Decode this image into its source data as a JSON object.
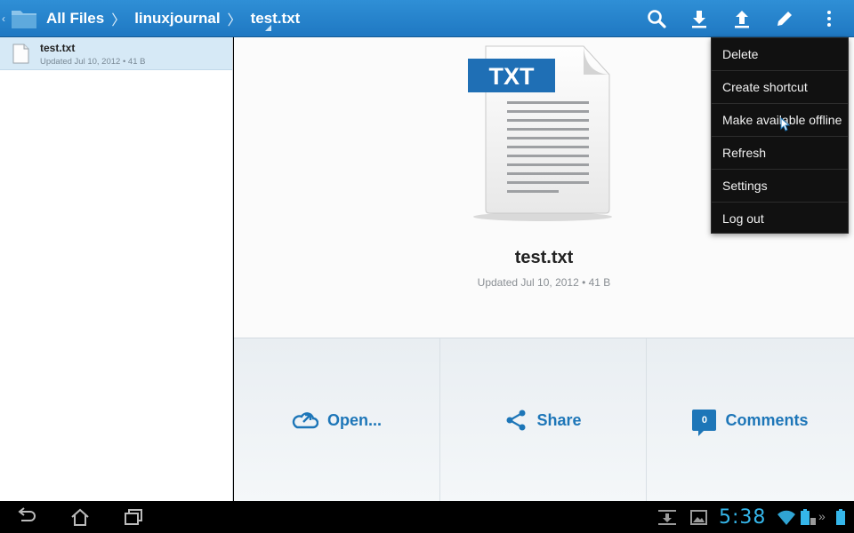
{
  "breadcrumb": {
    "root": "All Files",
    "folder": "linuxjournal",
    "file": "test.txt"
  },
  "toolbar": {
    "icons": [
      "search-icon",
      "download-icon",
      "upload-icon",
      "edit-icon",
      "overflow-menu-icon"
    ]
  },
  "file_list": [
    {
      "name": "test.txt",
      "meta": "Updated Jul 10, 2012 • 41 B"
    }
  ],
  "detail": {
    "badge": "TXT",
    "name": "test.txt",
    "meta": "Updated  Jul 10, 2012 • 41 B"
  },
  "actions": {
    "open_label": "Open...",
    "share_label": "Share",
    "comments_label": "Comments",
    "comments_count": "0"
  },
  "menu": {
    "items": [
      "Delete",
      "Create shortcut",
      "Make available offline",
      "Refresh",
      "Settings",
      "Log out"
    ]
  },
  "system": {
    "time": "5:38"
  },
  "colors": {
    "accent": "#1d76b8",
    "actionbar": "#2b89d0",
    "clock": "#35b6ea"
  }
}
